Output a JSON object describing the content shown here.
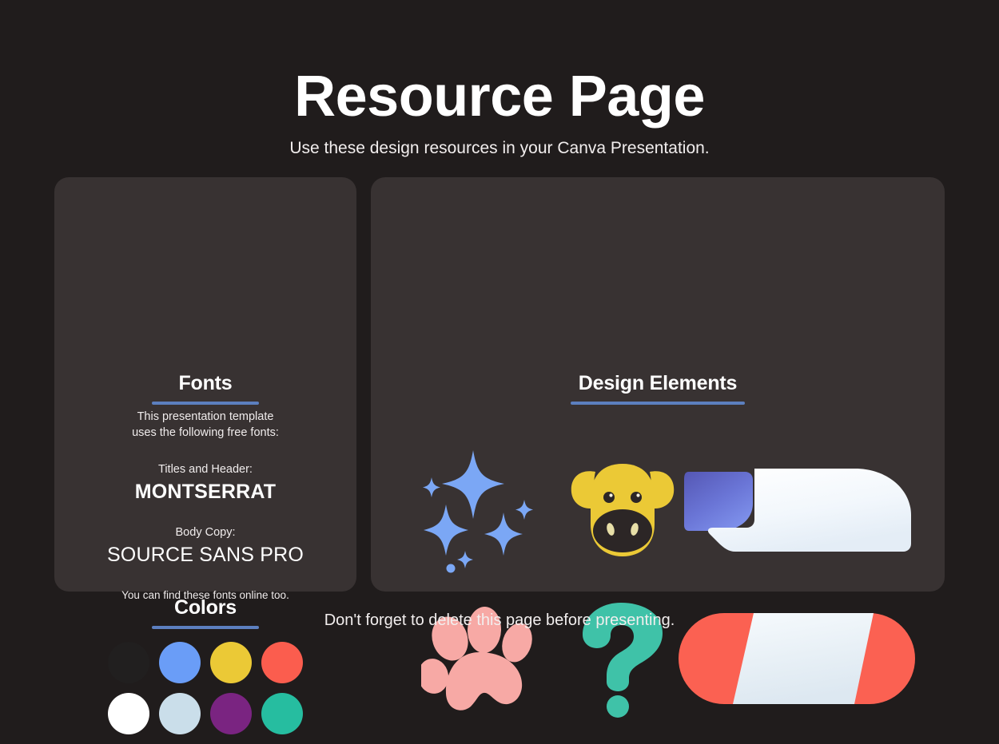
{
  "page": {
    "title": "Resource Page",
    "subtitle": "Use these design resources in your Canva Presentation.",
    "footer_note": "Don't forget to delete this page before presenting.",
    "background_color": "#201c1c",
    "panel_color": "#383232",
    "accent_rule_color": "#5c7fbf"
  },
  "fonts_panel": {
    "heading": "Fonts",
    "intro_line1": "This presentation template",
    "intro_line2": "uses the following free fonts:",
    "title_font_label": "Titles and Header:",
    "title_font_name": "MONTSERRAT",
    "body_font_label": "Body Copy:",
    "body_font_name": "SOURCE SANS PRO",
    "outro": "You can find these fonts online too."
  },
  "colors_panel": {
    "heading": "Colors",
    "swatches": [
      {
        "name": "swatch-dark-charcoal",
        "hex": "#211f1f"
      },
      {
        "name": "swatch-cornflower-blue",
        "hex": "#6a9df7"
      },
      {
        "name": "swatch-golden-yellow",
        "hex": "#ebc936"
      },
      {
        "name": "swatch-coral-red",
        "hex": "#fb5d4e"
      },
      {
        "name": "swatch-white",
        "hex": "#ffffff"
      },
      {
        "name": "swatch-pale-blue",
        "hex": "#cadeea"
      },
      {
        "name": "swatch-purple",
        "hex": "#7a2481"
      },
      {
        "name": "swatch-teal-green",
        "hex": "#26bda0"
      }
    ]
  },
  "design_panel": {
    "heading": "Design Elements",
    "elements": [
      {
        "name": "sparkles-icon",
        "label": "Sparkles",
        "color": "#7ba7f5"
      },
      {
        "name": "cow-face-icon",
        "label": "Cow Face",
        "color": "#ebc936"
      },
      {
        "name": "blue-white-blob-shape",
        "label": "Blue and White Blob",
        "color": "#6b7ce0"
      },
      {
        "name": "paw-print-icon",
        "label": "Paw Print",
        "color": "#f7a9a5"
      },
      {
        "name": "question-mark-icon",
        "label": "Question Mark",
        "color": "#3fc2a8"
      },
      {
        "name": "red-capsule-shape",
        "label": "Red Capsule",
        "color": "#fb6152"
      }
    ]
  }
}
